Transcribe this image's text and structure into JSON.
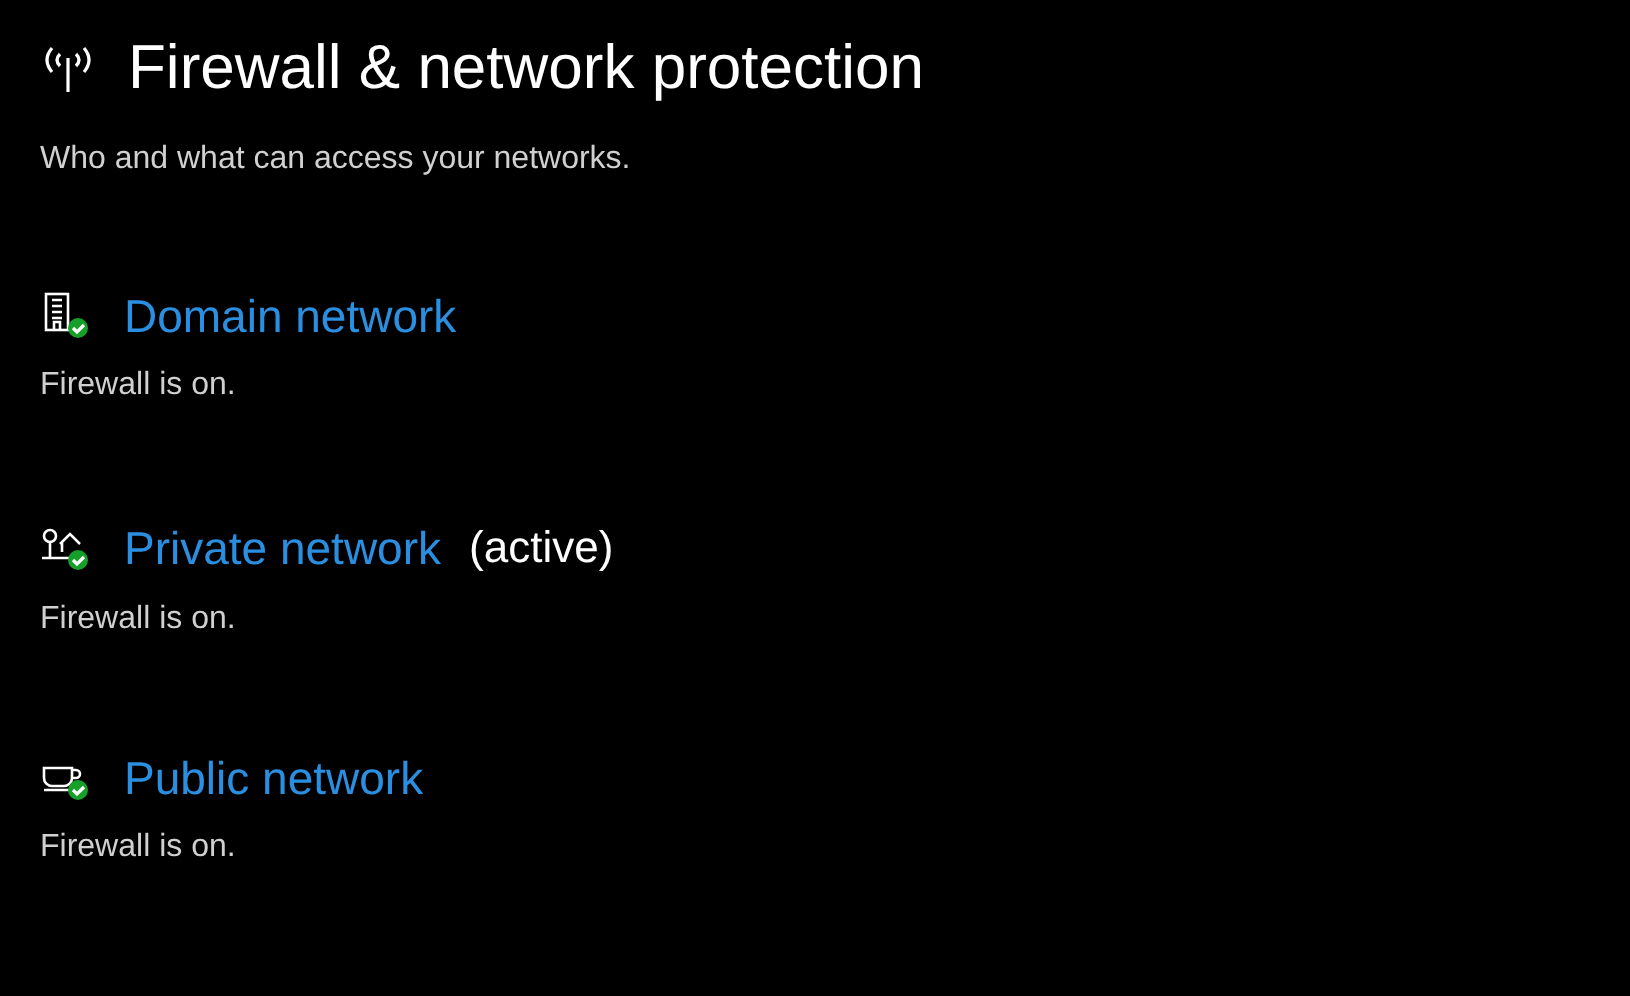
{
  "title": "Firewall & network protection",
  "subtitle": "Who and what can access your networks.",
  "networks": [
    {
      "kind": "domain",
      "name": "Domain network",
      "status": "Firewall is on.",
      "on": true
    },
    {
      "kind": "private",
      "name": "Private network",
      "active_label": "(active)",
      "status": "Firewall is on.",
      "on": true
    },
    {
      "kind": "public",
      "name": "Public network",
      "status": "Firewall is on.",
      "on": true
    }
  ]
}
